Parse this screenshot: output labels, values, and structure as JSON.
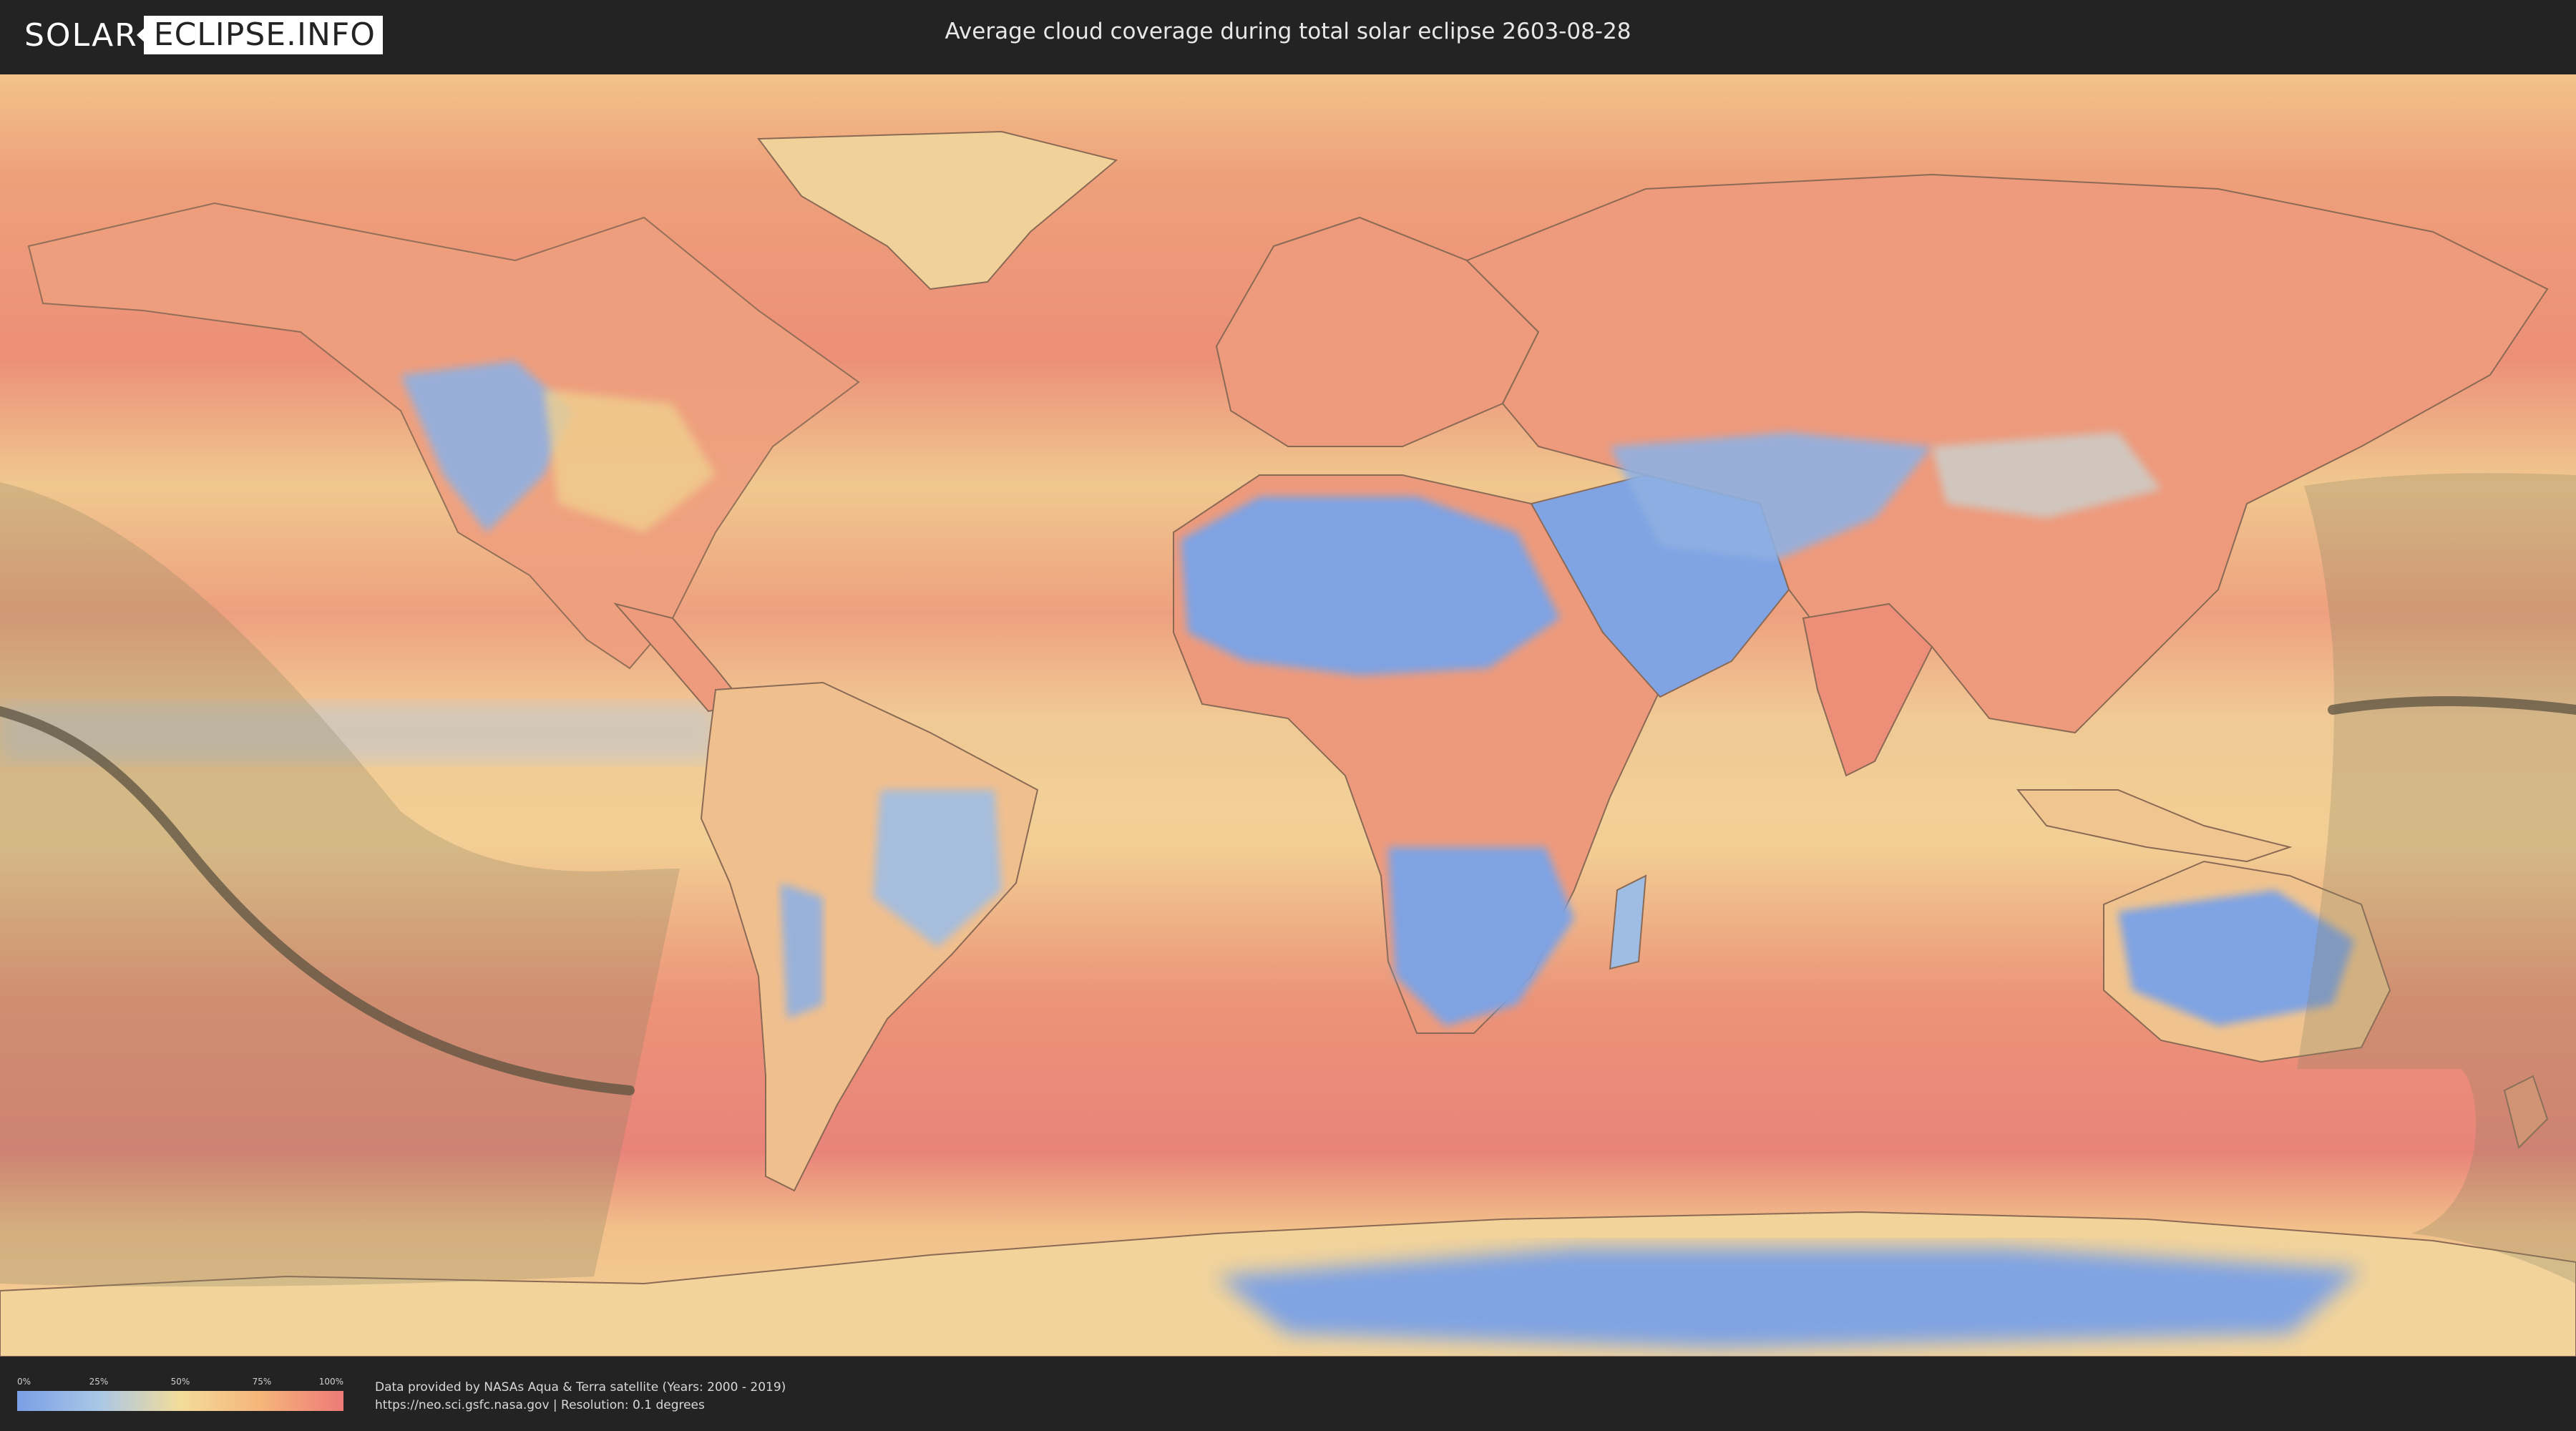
{
  "header": {
    "logo_solar": "SOLAR",
    "logo_eclipse": "ECLIPSE.INFO",
    "title": "Average cloud coverage during total solar eclipse 2603-08-28"
  },
  "legend": {
    "ticks": [
      "0%",
      "25%",
      "50%",
      "75%",
      "100%"
    ],
    "gradient_colors": [
      "#7a9fe6",
      "#a9c7e6",
      "#f3dc9a",
      "#f5b47a",
      "#ee7a78"
    ]
  },
  "credits": {
    "line1": "Data provided by NASAs Aqua & Terra satellite (Years: 2000 - 2019)",
    "line2": "https://neo.sci.gsfc.nasa.gov | Resolution: 0.1 degrees"
  },
  "map": {
    "ocean_color": "#e9a383",
    "land_clear_color": "#7fa3e3",
    "land_mixed_color": "#f0cf8e",
    "shadow_color": "#8a8260",
    "central_line_color": "#5b5240"
  }
}
